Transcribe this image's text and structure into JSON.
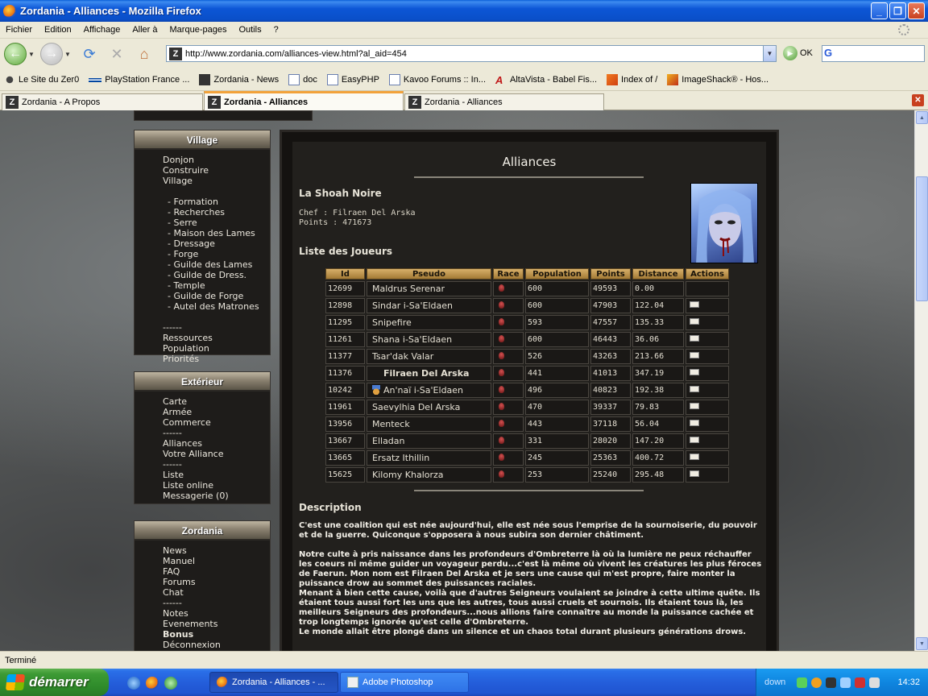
{
  "window": {
    "title": "Zordania - Alliances - Mozilla Firefox"
  },
  "menu": [
    "Fichier",
    "Edition",
    "Affichage",
    "Aller à",
    "Marque-pages",
    "Outils",
    "?"
  ],
  "nav": {
    "url": "http://www.zordania.com/alliances-view.html?al_aid=454",
    "go_label": "OK",
    "search_letter": "G"
  },
  "bookmarks": [
    "Le Site du Zer0",
    "PlayStation France ...",
    "Zordania - News",
    "doc",
    "EasyPHP",
    "Kavoo Forums :: In...",
    "AltaVista - Babel Fis...",
    "Index of /",
    "ImageShack® - Hos..."
  ],
  "tabs": [
    {
      "label": "Zordania - A Propos"
    },
    {
      "label": "Zordania - Alliances"
    },
    {
      "label": "Zordania - Alliances"
    }
  ],
  "sidebar": {
    "village": {
      "title": "Village",
      "items": [
        {
          "label": "Donjon",
          "sub": false
        },
        {
          "label": "Construire",
          "sub": false
        },
        {
          "label": "Village",
          "sub": false
        },
        {
          "label": "",
          "sub": false
        },
        {
          "label": "- Formation",
          "sub": true
        },
        {
          "label": "- Recherches",
          "sub": true
        },
        {
          "label": "- Serre",
          "sub": true
        },
        {
          "label": "- Maison des Lames",
          "sub": true
        },
        {
          "label": "- Dressage",
          "sub": true
        },
        {
          "label": "- Forge",
          "sub": true
        },
        {
          "label": "- Guilde des Lames",
          "sub": true
        },
        {
          "label": "- Guilde de Dress.",
          "sub": true
        },
        {
          "label": "- Temple",
          "sub": true
        },
        {
          "label": "- Guilde de Forge",
          "sub": true
        },
        {
          "label": "- Autel des Matrones",
          "sub": true
        },
        {
          "label": "",
          "sub": false
        },
        {
          "label": "------",
          "sub": false
        },
        {
          "label": "Ressources",
          "sub": false
        },
        {
          "label": "Population",
          "sub": false
        },
        {
          "label": "Priorités",
          "sub": false
        }
      ]
    },
    "exterieur": {
      "title": "Extérieur",
      "items": [
        "Carte",
        "Armée",
        "Commerce",
        "------",
        "Alliances",
        "Votre Alliance",
        "------",
        "Liste",
        "Liste online",
        "Messagerie (0)"
      ]
    },
    "zordania": {
      "title": "Zordania",
      "items": [
        "News",
        "Manuel",
        "FAQ",
        "Forums",
        "Chat",
        "------",
        "Notes",
        "Evenements",
        "Bonus",
        "Déconnexion"
      ]
    }
  },
  "main": {
    "title": "Alliances",
    "alliance_name": "La Shoah Noire",
    "chef_line": "Chef : Filraen Del Arska",
    "points_line": "Points : 471673",
    "players_title": "Liste des Joueurs",
    "columns": [
      "Id",
      "Pseudo",
      "Race",
      "Population",
      "Points",
      "Distance",
      "Actions"
    ],
    "players": [
      {
        "id": "12699",
        "pseudo": "Maldrus Serenar",
        "population": "600",
        "points": "49593",
        "distance": "0.00",
        "mail": false,
        "chef": false,
        "medal": false
      },
      {
        "id": "12898",
        "pseudo": "Sindar i-Sa'Eldaen",
        "population": "600",
        "points": "47903",
        "distance": "122.04",
        "mail": true,
        "chef": false,
        "medal": false
      },
      {
        "id": "11295",
        "pseudo": "Snipefire",
        "population": "593",
        "points": "47557",
        "distance": "135.33",
        "mail": true,
        "chef": false,
        "medal": false
      },
      {
        "id": "11261",
        "pseudo": "Shana i-Sa'Eldaen",
        "population": "600",
        "points": "46443",
        "distance": "36.06",
        "mail": true,
        "chef": false,
        "medal": false
      },
      {
        "id": "11377",
        "pseudo": "Tsar'dak Valar",
        "population": "526",
        "points": "43263",
        "distance": "213.66",
        "mail": true,
        "chef": false,
        "medal": false
      },
      {
        "id": "11376",
        "pseudo": "Filraen Del Arska",
        "population": "441",
        "points": "41013",
        "distance": "347.19",
        "mail": true,
        "chef": true,
        "medal": false
      },
      {
        "id": "10242",
        "pseudo": "An'naï i-Sa'Eldaen",
        "population": "496",
        "points": "40823",
        "distance": "192.38",
        "mail": true,
        "chef": false,
        "medal": true
      },
      {
        "id": "11961",
        "pseudo": "Saevylhia Del Arska",
        "population": "470",
        "points": "39337",
        "distance": "79.83",
        "mail": true,
        "chef": false,
        "medal": false
      },
      {
        "id": "13956",
        "pseudo": "Menteck",
        "population": "443",
        "points": "37118",
        "distance": "56.04",
        "mail": true,
        "chef": false,
        "medal": false
      },
      {
        "id": "13667",
        "pseudo": "Elladan",
        "population": "331",
        "points": "28020",
        "distance": "147.20",
        "mail": true,
        "chef": false,
        "medal": false
      },
      {
        "id": "13665",
        "pseudo": "Ersatz Ithillin",
        "population": "245",
        "points": "25363",
        "distance": "400.72",
        "mail": true,
        "chef": false,
        "medal": false
      },
      {
        "id": "15625",
        "pseudo": "Kilomy Khalorza",
        "population": "253",
        "points": "25240",
        "distance": "295.48",
        "mail": true,
        "chef": false,
        "medal": false
      }
    ],
    "description_title": "Description",
    "description_p1": "C'est une coalition qui est née aujourd'hui, elle est née sous l'emprise de la sournoiserie, du pouvoir et de la guerre. Quiconque s'opposera à nous subira son dernier châtiment.",
    "description_p2": "Notre culte à pris naissance dans les profondeurs d'Ombreterre là où la lumière ne peux réchauffer les coeurs ni même guider un voyageur perdu...c'est là même où vivent les créatures les plus féroces de Faerun. Mon nom est Filraen Del Arska et je sers une cause qui m'est propre, faire monter la puissance drow au sommet des puissances raciales.",
    "description_p3": "Menant à bien cette cause, voilà que d'autres Seigneurs voulaient se joindre à cette ultime quête. Ils étaient tous aussi fort les uns que les autres, tous aussi cruels et sournois. Ils étaient tous là, les meilleurs Seigneurs des profondeurs...nous allions faire connaître au monde la puissance cachée et trop longtemps ignorée qu'est celle d'Ombreterre.",
    "description_p4": "Le monde allait être plongé dans un silence et un chaos total durant plusieurs générations drows."
  },
  "status": "Terminé",
  "taskbar": {
    "start_label": "démarrer",
    "items": [
      "Zordania - Alliances - ...",
      "Adobe Photoshop"
    ],
    "tray_label": "down",
    "clock": "14:32"
  }
}
